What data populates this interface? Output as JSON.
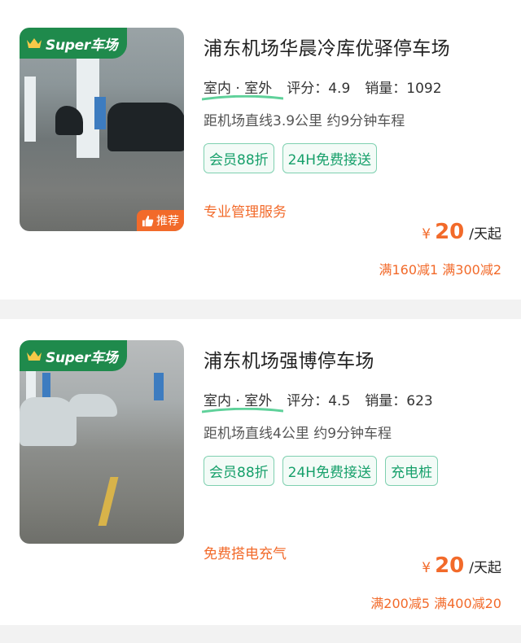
{
  "colors": {
    "brand_green": "#1f8a4c",
    "accent_orange": "#f26a2a",
    "tag_green": "#17a06b"
  },
  "listings": [
    {
      "badge_text": "Super车场",
      "badge_icon": "crown-icon",
      "recommend_label": "推荐",
      "recommend_icon": "thumbs-up-icon",
      "title": "浦东机场华晨冷库优驿停车场",
      "location_type": "室内 · 室外",
      "rating_label": "评分：4.9",
      "sales_label": "销量：1092",
      "distance": "距机场直线3.9公里 约9分钟车程",
      "tags": [
        "会员88折",
        "24H免费接送"
      ],
      "service": "专业管理服务",
      "price_symbol": "¥",
      "price_value": "20",
      "price_unit": "/天起",
      "promo": "满160减1 满300减2"
    },
    {
      "badge_text": "Super车场",
      "badge_icon": "crown-icon",
      "title": "浦东机场强博停车场",
      "location_type": "室内 · 室外",
      "rating_label": "评分：4.5",
      "sales_label": "销量：623",
      "distance": "距机场直线4公里 约9分钟车程",
      "tags": [
        "会员88折",
        "24H免费接送",
        "充电桩"
      ],
      "service": "免费搭电充气",
      "price_symbol": "¥",
      "price_value": "20",
      "price_unit": "/天起",
      "promo": "满200减5 满400减20"
    }
  ]
}
